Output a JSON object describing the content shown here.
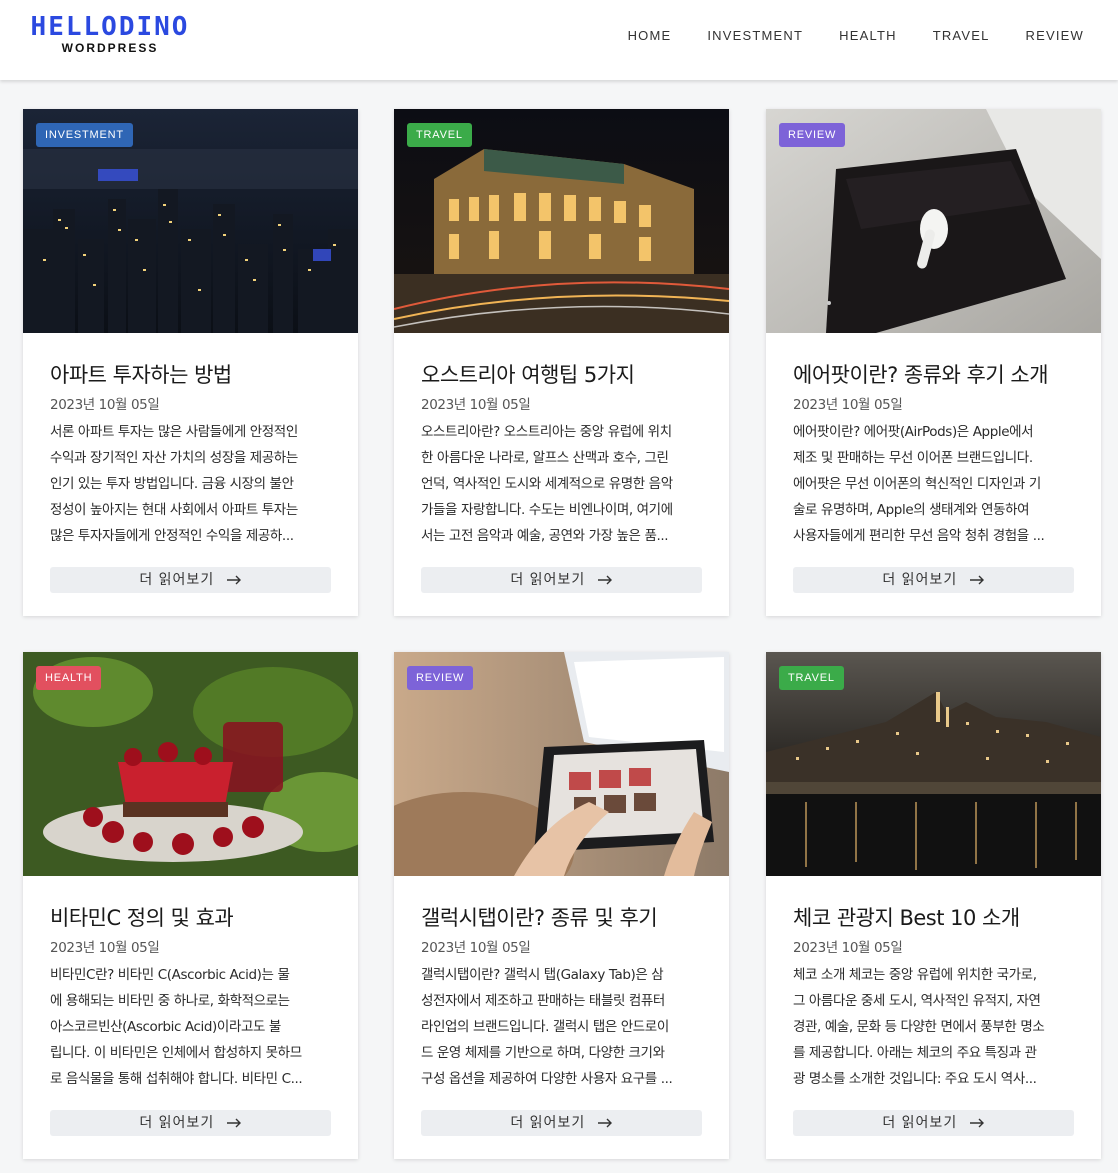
{
  "site": {
    "logo_main": "HELLODINO",
    "logo_sub": "WORDPRESS"
  },
  "nav": [
    {
      "label": "HOME"
    },
    {
      "label": "INVESTMENT"
    },
    {
      "label": "HEALTH"
    },
    {
      "label": "TRAVEL"
    },
    {
      "label": "REVIEW"
    }
  ],
  "read_more_label": "더 읽어보기",
  "colors": {
    "investment": "#2f66b5",
    "travel": "#3bab49",
    "review": "#7d63d8",
    "health": "#e2505f",
    "logo": "#2b49e0"
  },
  "posts": [
    {
      "category": "INVESTMENT",
      "title": "아파트 투자하는 방법",
      "date": "2023년 10월 05일",
      "excerpt": [
        "서론 아파트 투자는 많은 사람들에게 안정적인",
        "수익과 장기적인 자산 가치의 성장을 제공하는",
        "인기 있는 투자 방법입니다. 금융 시장의 불안",
        "정성이 높아지는 현대 사회에서 아파트 투자는",
        "많은 투자자들에게 안정적인 수익을 제공하..."
      ],
      "image": "city-night-skyline"
    },
    {
      "category": "TRAVEL",
      "title": "오스트리아 여행팁 5가지",
      "date": "2023년 10월 05일",
      "excerpt": [
        "오스트리아란? 오스트리아는 중앙 유럽에 위치",
        "한 아름다운 나라로, 알프스 산맥과 호수, 그린",
        "언덕, 역사적인 도시와 세계적으로 유명한 음악",
        "가들을 자랑합니다. 수도는 비엔나이며, 여기에",
        "서는 고전 음악과 예술, 공연와 가장 높은 품..."
      ],
      "image": "vienna-opera-night"
    },
    {
      "category": "REVIEW",
      "title": "에어팟이란? 종류와 후기 소개",
      "date": "2023년 10월 05일",
      "excerpt": [
        "에어팟이란? 에어팟(AirPods)은 Apple에서",
        "제조 및 판매하는 무선 이어폰 브랜드입니다.",
        "에어팟은 무선 이어폰의 혁신적인 디자인과 기",
        "술로 유명하며, Apple의 생태계와 연동하여",
        "사용자들에게 편리한 무선 음악 청취 경험을 ..."
      ],
      "image": "airpod-on-phone"
    },
    {
      "category": "HEALTH",
      "title": "비타민C 정의 및 효과",
      "date": "2023년 10월 05일",
      "excerpt": [
        "비타민C란? 비타민 C(Ascorbic Acid)는 물",
        "에 용해되는 비타민 중 하나로, 화학적으로는",
        "아스코르빈산(Ascorbic Acid)이라고도 불",
        "립니다. 이 비타민은 인체에서 합성하지 못하므",
        "로 음식물을 통해 섭취해야 합니다. 비타민 C..."
      ],
      "image": "cherries-and-cake"
    },
    {
      "category": "REVIEW",
      "title": "갤럭시탭이란? 종류 및 후기",
      "date": "2023년 10월 05일",
      "excerpt": [
        "갤럭시탭이란? 갤럭시 탭(Galaxy Tab)은 삼",
        "성전자에서 제조하고 판매하는 태블릿 컴퓨터",
        "라인업의 브랜드입니다. 갤럭시 탭은 안드로이",
        "드 운영 체제를 기반으로 하며, 다양한 크기와",
        "구성 옵션을 제공하여 다양한 사용자 요구를 ..."
      ],
      "image": "hands-on-tablet"
    },
    {
      "category": "TRAVEL",
      "title": "체코 관광지 Best 10 소개",
      "date": "2023년 10월 05일",
      "excerpt": [
        "체코 소개 체코는 중앙 유럽에 위치한 국가로,",
        "그 아름다운 중세 도시, 역사적인 유적지, 자연",
        "경관, 예술, 문화 등 다양한 면에서 풍부한 명소",
        "를 제공합니다. 아래는 체코의 주요 특징과 관",
        "광 명소를 소개한 것입니다: 주요 도시 역사..."
      ],
      "image": "prague-castle-night"
    }
  ]
}
